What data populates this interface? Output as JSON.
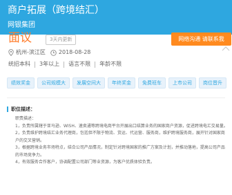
{
  "header": {
    "title": "商户拓展（跨境结汇）",
    "company": "网银集团"
  },
  "job": {
    "salary": "面议",
    "update_badge": "3天内更新",
    "apply_label": "网络沟通 请联系我",
    "location": "杭州-滨江区",
    "date": "2018-08-28",
    "requirements": [
      "统招本科",
      "3年以上",
      "语言不限",
      "年龄不限"
    ]
  },
  "tags": [
    "绩效奖金",
    "公司规模大",
    "发展空间大",
    "年终奖金",
    "免费班车",
    "上市公司",
    "岗位晋升"
  ],
  "description": {
    "heading": "职位描述：",
    "lines": [
      "职责描述：",
      "1，负责所属辖于亚马逊、WISH、速卖通等跨境电商平台开展出口结算业务的国家商户资源，促进跨境电汇交易量。",
      "2，负责维护跨境结汇业务代理商，包括但不限于物流、货运、代运营、服务商，维护跨境服务商，展开针对国家商户的交叉营销。",
      "3，根据跨境业务市场特点，结合公司产品情况，制定针对跨境国家的推广方案及计划，并推动落地，提高公司产品的市场竞争力。",
      "4，有效服务合作客户，协调配置公司部门等业资源，为客户优质体验负责。"
    ]
  },
  "colors": {
    "header_bg": "#2ea7e0",
    "salary": "#ff7e2e",
    "apply_bg": "#ff8a1f",
    "tag_bg": "#e8f2fb"
  },
  "icons": [
    "location-pin-icon",
    "clock-icon",
    "arrow-icon"
  ]
}
